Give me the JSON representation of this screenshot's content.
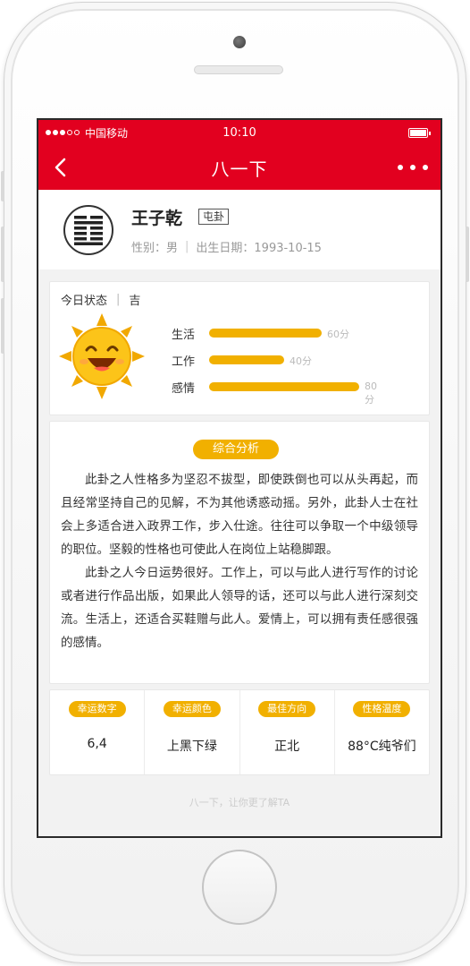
{
  "statusbar": {
    "carrier": "中国移动",
    "time": "10:10"
  },
  "navbar": {
    "title": "八一下"
  },
  "profile": {
    "name": "王子乾",
    "gua": "屯卦",
    "gender": "性别：男",
    "birth": "出生日期：1993-10-15"
  },
  "today": {
    "label": "今日状态",
    "fortune": "吉",
    "items": [
      {
        "label": "生活",
        "value": 60,
        "value_text": "60分"
      },
      {
        "label": "工作",
        "value": 40,
        "value_text": "40分"
      },
      {
        "label": "感情",
        "value": 80,
        "value_text": "80分"
      }
    ]
  },
  "analysis": {
    "title": "综合分析",
    "paragraphs": [
      "此卦之人性格多为坚忍不拔型，即使跌倒也可以从头再起，而且经常坚持自己的见解，不为其他诱惑动摇。另外，此卦人士在社会上多适合进入政界工作，步入仕途。往往可以争取一个中级领导的职位。坚毅的性格也可使此人在岗位上站稳脚跟。",
      "此卦之人今日运势很好。工作上，可以与此人进行写作的讨论或者进行作品出版，如果此人领导的话，还可以与此人进行深刻交流。生活上，还适合买鞋赠与此人。爱情上，可以拥有责任感很强的感情。"
    ]
  },
  "lucky": [
    {
      "label": "幸运数字",
      "value": "6,4"
    },
    {
      "label": "幸运颜色",
      "value": "上黑下绿"
    },
    {
      "label": "最佳方向",
      "value": "正北"
    },
    {
      "label": "性格温度",
      "value": "88°C纯爷们"
    }
  ],
  "footer": "八一下，让你更了解TA",
  "colors": {
    "brand_red": "#e2001f",
    "accent_yellow": "#f1b000"
  }
}
